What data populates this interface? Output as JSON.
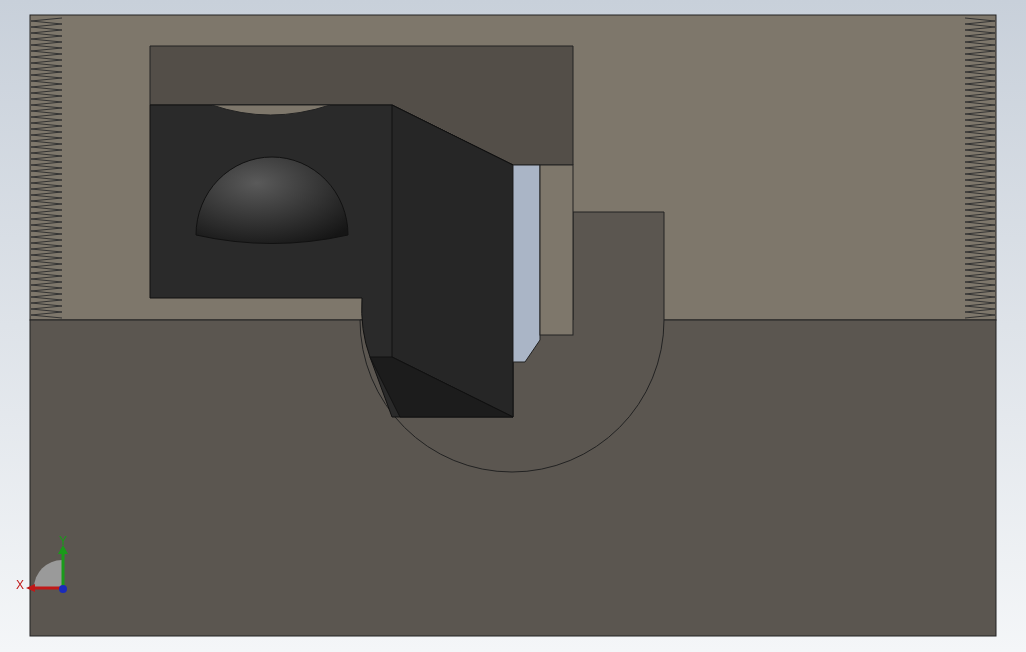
{
  "triad": {
    "x_label": "X",
    "y_label": "Y"
  }
}
